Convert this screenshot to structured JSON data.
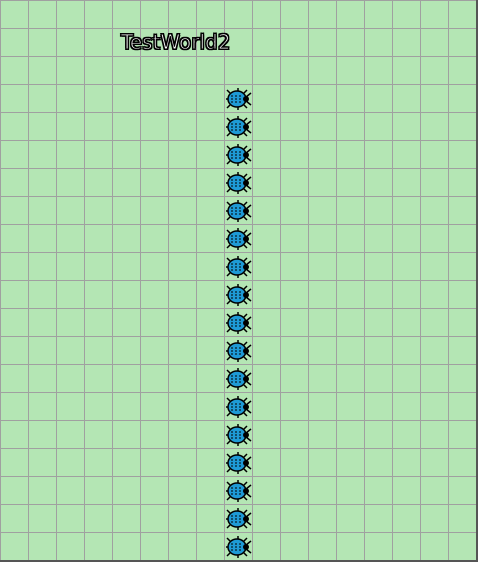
{
  "world": {
    "title": "TestWorld2",
    "grid_color": "#a0a0a0",
    "background_color": "#b4e6b4"
  },
  "actors": {
    "type": "bug-icon",
    "count": 17,
    "body_color": "#1e9ad6",
    "outline_color": "#000000",
    "facing": "right"
  }
}
